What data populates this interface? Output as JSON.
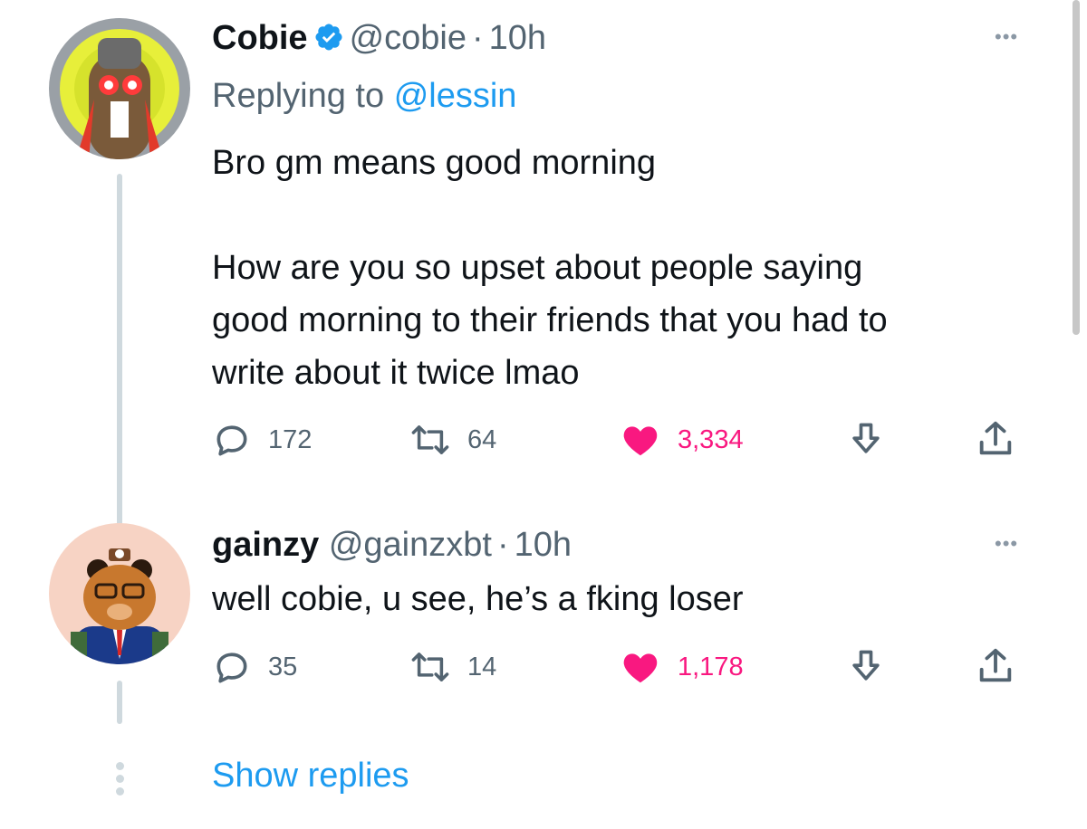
{
  "tweets": [
    {
      "name": "Cobie",
      "verified": true,
      "handle": "@cobie",
      "dot": "·",
      "time": "10h",
      "replying_prefix": "Replying to",
      "replying_to": "@lessin",
      "text": "Bro gm means good morning\n\nHow are you so upset about people saying\ngood morning to their friends that you had to\nwrite about it twice lmao",
      "replies": "172",
      "retweets": "64",
      "likes": "3,334",
      "liked": true
    },
    {
      "name": "gainzy",
      "verified": false,
      "handle": "@gainzxbt",
      "dot": "·",
      "time": "10h",
      "text": "well cobie, u see, he’s a fking loser",
      "replies": "35",
      "retweets": "14",
      "likes": "1,178",
      "liked": true
    }
  ],
  "more_label": "•••",
  "show_replies": "Show replies",
  "colors": {
    "like": "#f91880",
    "link": "#1d9bf0",
    "verified": "#1d9bf0",
    "muted": "#536471",
    "thread_line": "#cfd9de"
  },
  "icons": [
    "reply-icon",
    "retweet-icon",
    "heart-icon",
    "download-icon",
    "share-icon",
    "verified-badge-icon",
    "more-icon"
  ]
}
